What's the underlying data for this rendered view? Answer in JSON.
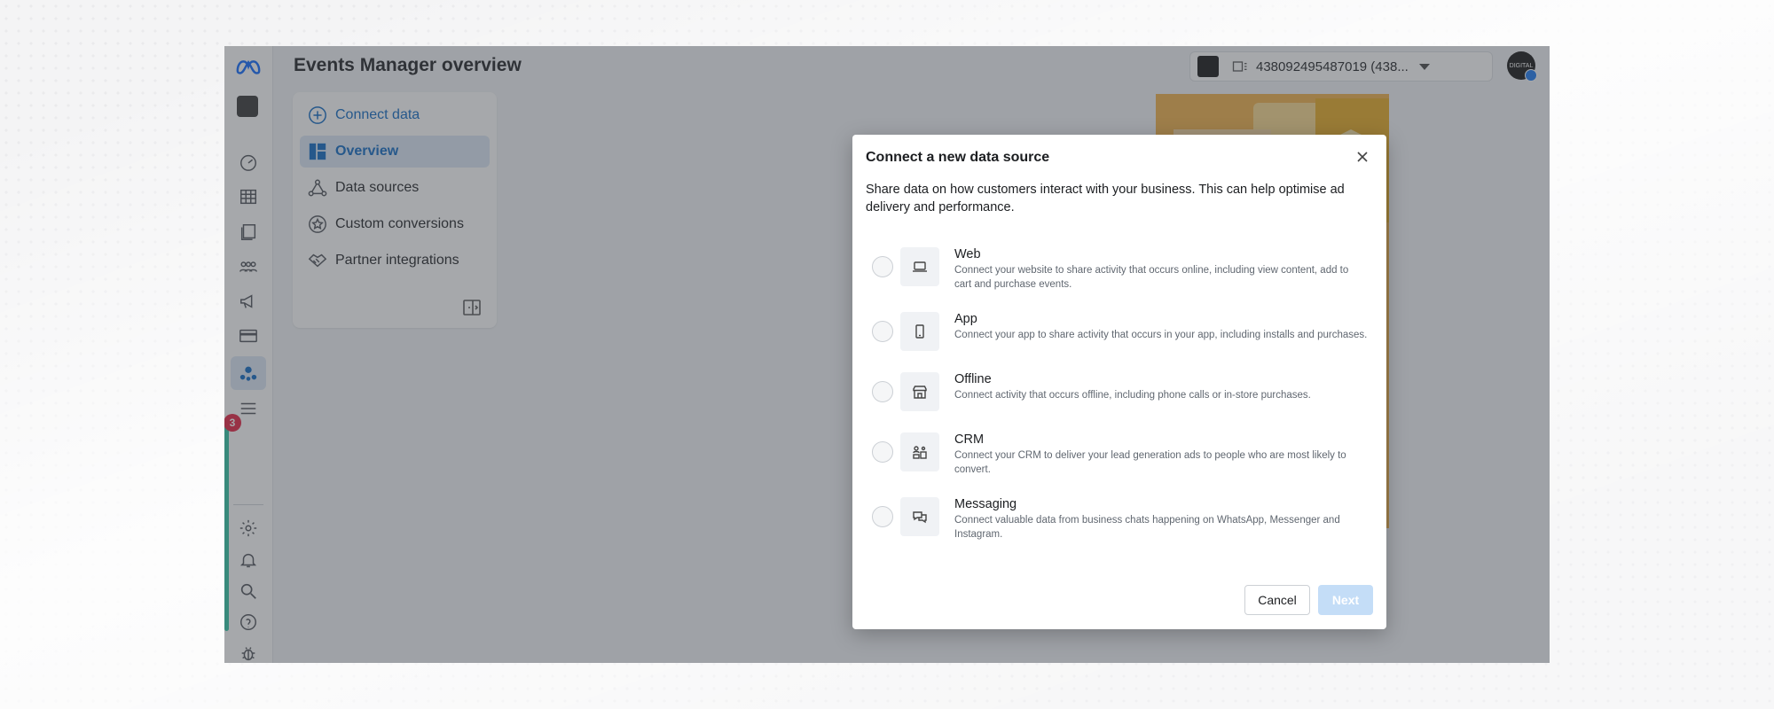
{
  "header": {
    "title": "Events Manager overview",
    "account": "438092495487019 (438..."
  },
  "rail": {
    "badge": "3"
  },
  "sidebar": {
    "items": [
      {
        "label": "Connect data",
        "icon": "plus-circle-icon"
      },
      {
        "label": "Overview",
        "icon": "overview-icon"
      },
      {
        "label": "Data sources",
        "icon": "data-sources-icon"
      },
      {
        "label": "Custom conversions",
        "icon": "star-badge-icon"
      },
      {
        "label": "Partner integrations",
        "icon": "handshake-icon"
      }
    ]
  },
  "modal": {
    "title": "Connect a new data source",
    "description": "Share data on how customers interact with your business. This can help optimise ad delivery and performance.",
    "options": [
      {
        "name": "Web",
        "description": "Connect your website to share activity that occurs online, including view content, add to cart and purchase events.",
        "icon": "laptop-icon"
      },
      {
        "name": "App",
        "description": "Connect your app to share activity that occurs in your app, including installs and purchases.",
        "icon": "mobile-icon"
      },
      {
        "name": "Offline",
        "description": "Connect activity that occurs offline, including phone calls or in-store purchases.",
        "icon": "store-icon"
      },
      {
        "name": "CRM",
        "description": "Connect your CRM to deliver your lead generation ads to people who are most likely to convert.",
        "icon": "crm-icon"
      },
      {
        "name": "Messaging",
        "description": "Connect valuable data from business chats happening on WhatsApp, Messenger and Instagram.",
        "icon": "chat-icon"
      }
    ],
    "cancel_label": "Cancel",
    "next_label": "Next"
  },
  "colors": {
    "accent": "#0a66c2",
    "badge": "#e41e3f",
    "next_disabled": "#c4ddf7"
  }
}
